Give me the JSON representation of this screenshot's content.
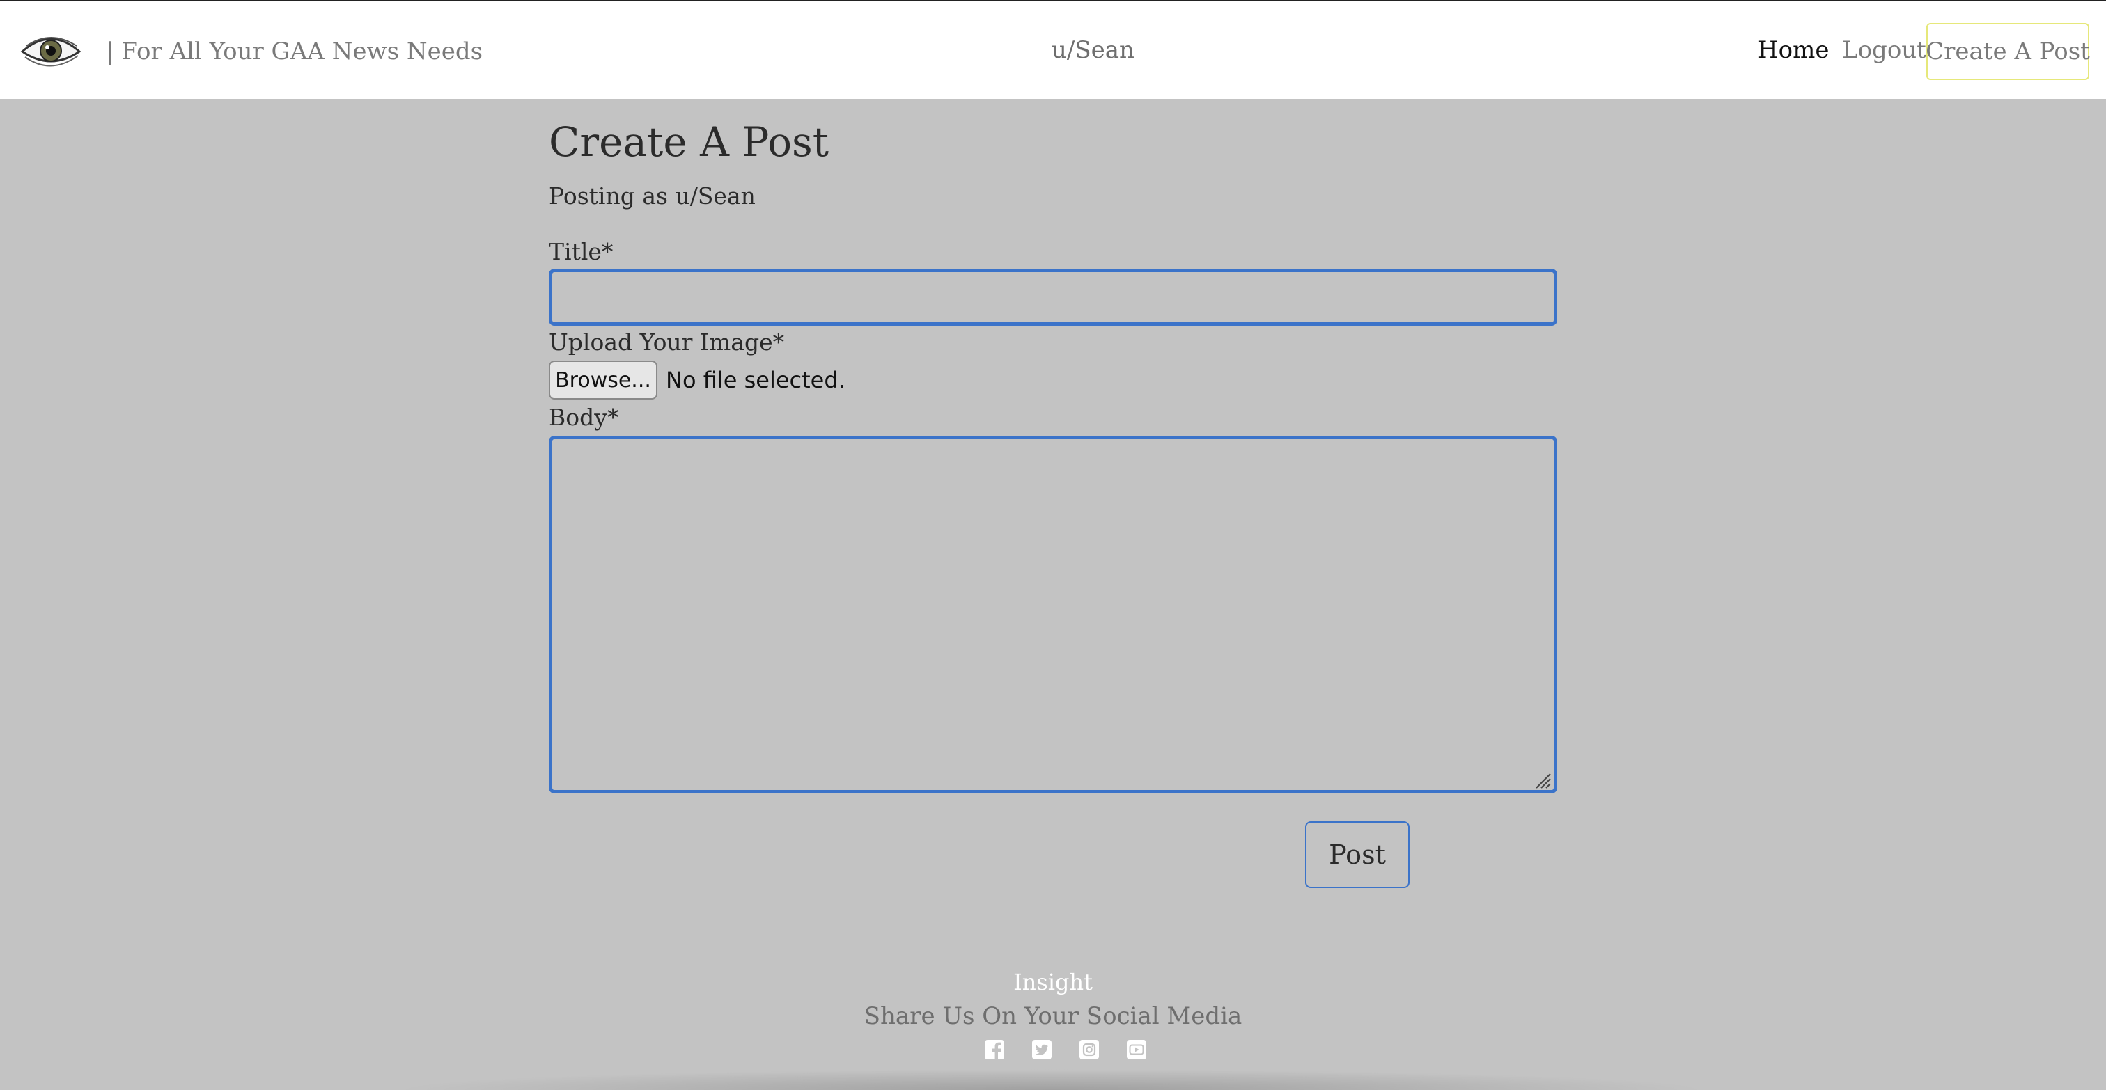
{
  "navbar": {
    "tagline": "| For All Your GAA News Needs",
    "username": "u/Sean",
    "links": {
      "home": "Home",
      "logout": "Logout",
      "create_post": "Create A Post"
    },
    "logo_icon": "eye-icon"
  },
  "form": {
    "title": "Create A Post",
    "posting_as": "Posting as u/Sean",
    "title_label": "Title*",
    "title_value": "",
    "image_label": "Upload Your Image*",
    "browse_label": "Browse...",
    "file_status": "No file selected.",
    "body_label": "Body*",
    "body_value": "",
    "submit_label": "Post",
    "accent_color": "#3b73c9"
  },
  "footer": {
    "brand": "Insight",
    "share": "Share Us On Your Social Media",
    "social_icons": [
      "facebook-icon",
      "twitter-icon",
      "instagram-icon",
      "youtube-icon"
    ]
  }
}
